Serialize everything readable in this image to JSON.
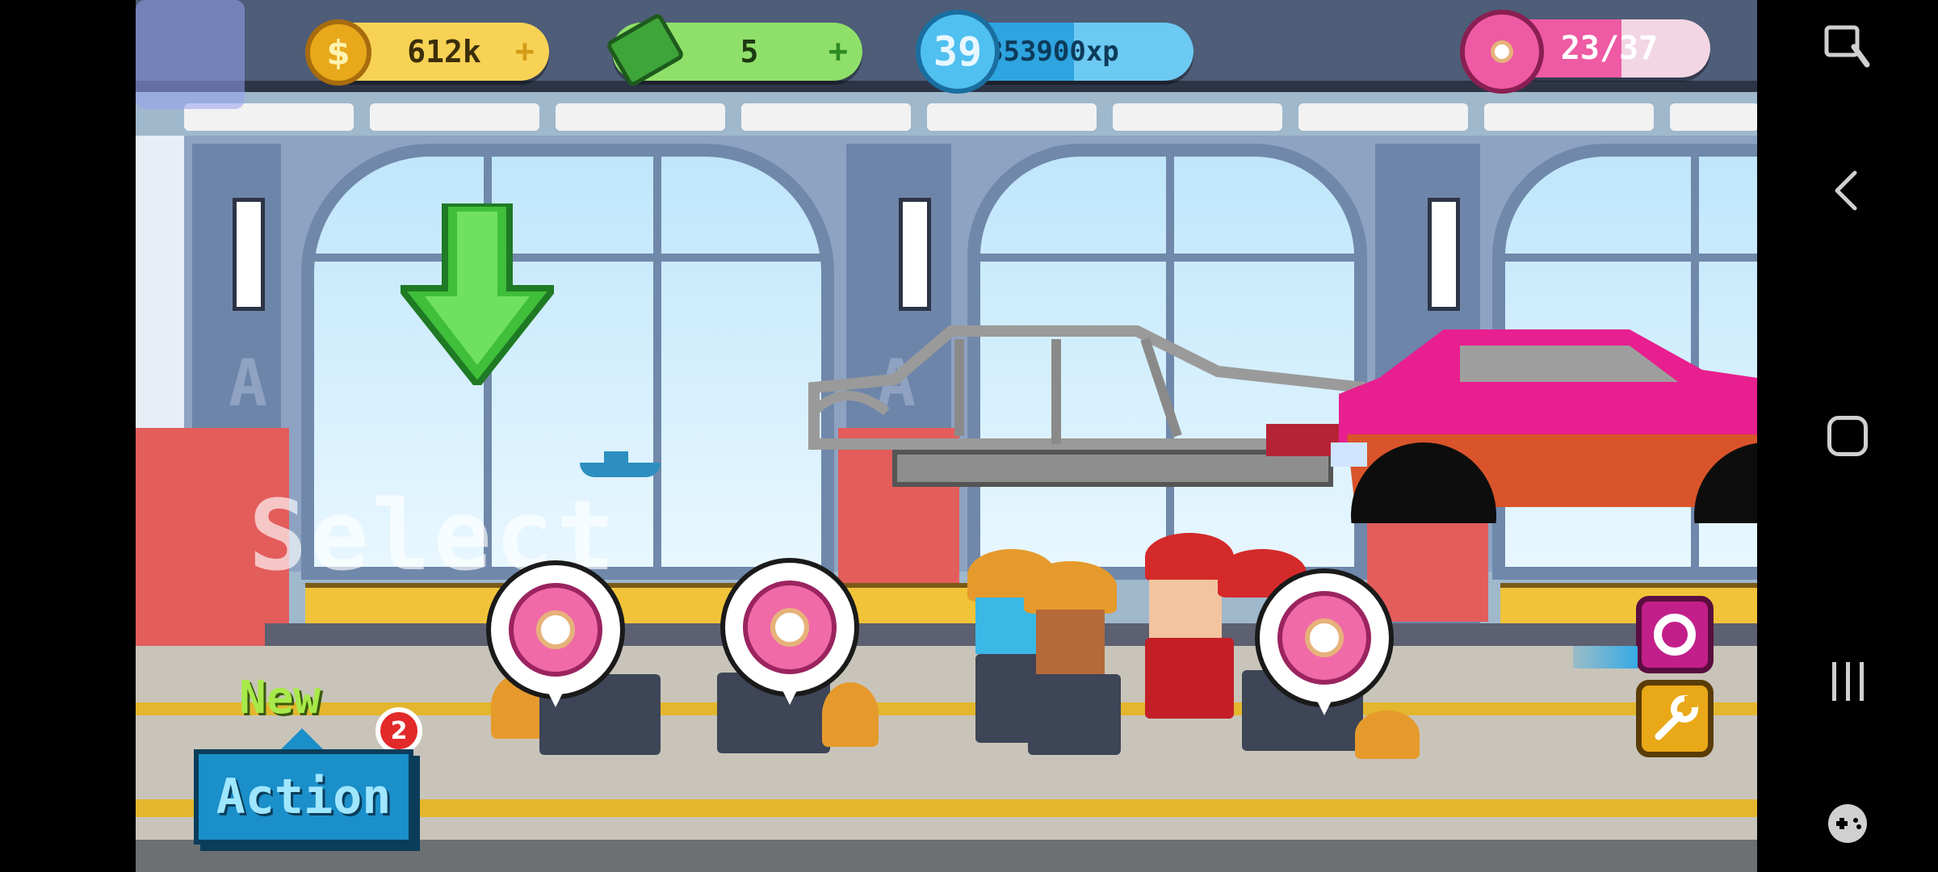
{
  "hud": {
    "coins": "612k",
    "cash": "5",
    "level": "39",
    "xp": "353900xp",
    "xp_progress": 0.55,
    "donuts": "23/37",
    "donuts_progress": 0.62,
    "plus": "+"
  },
  "scene": {
    "overlay_text": "Select",
    "lot_letter": "A"
  },
  "action": {
    "new_label": "New",
    "badge_count": "2",
    "button_label": "Action"
  },
  "colors": {
    "coin": "#f7c23c",
    "cash": "#6bd45a",
    "xp": "#39b6f0",
    "donut": "#ee5aa3",
    "action": "#1a8fc9"
  },
  "navbar": {
    "icons": [
      "screenshot-icon",
      "back-icon",
      "home-icon",
      "recents-icon",
      "game-launcher-icon"
    ]
  }
}
